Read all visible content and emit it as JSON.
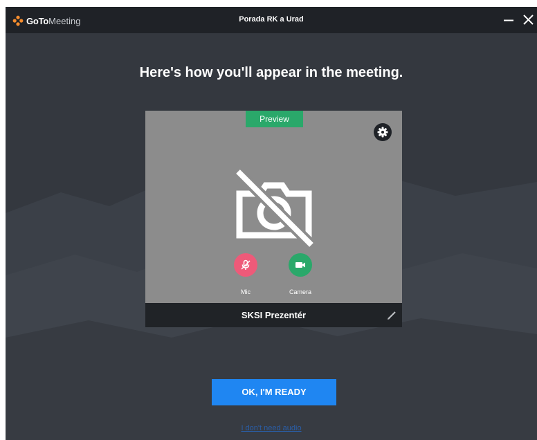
{
  "app": {
    "logo_goto": "GoTo",
    "logo_meeting": "Meeting",
    "window_title": "Porada RK a Urad"
  },
  "titlebar": {
    "minimize_icon": "minimize-icon",
    "close_icon": "close-icon"
  },
  "main": {
    "headline": "Here's how you'll appear in the meeting."
  },
  "preview": {
    "badge": "Preview",
    "settings_icon": "gear-icon",
    "camera_state_icon": "camera-off-icon",
    "mic_label": "Mic",
    "camera_label": "Camera",
    "mic_state": "muted",
    "camera_state": "off",
    "display_name": "SKSI Prezentér",
    "edit_icon": "pencil-icon"
  },
  "actions": {
    "ok_label": "OK, I'M READY",
    "no_audio_label": "I don't need audio"
  },
  "colors": {
    "background": "#34383f",
    "titlebar": "#1f2227",
    "preview_area": "#8c8c8c",
    "preview_badge": "#2aa86a",
    "mic_button": "#ee5a79",
    "camera_button": "#2aa86a",
    "primary_button": "#1f86f2",
    "link": "#2a5ea8",
    "logo_accent": "#f68d2e"
  }
}
